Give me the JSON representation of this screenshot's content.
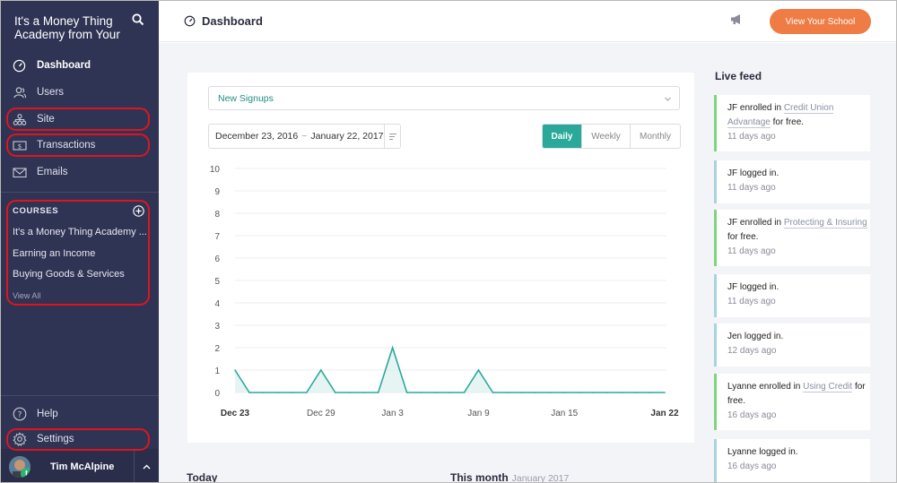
{
  "sidebar": {
    "brand": "It's a Money Thing Academy from Your",
    "nav": [
      {
        "label": "Dashboard",
        "icon": "gauge-icon"
      },
      {
        "label": "Users",
        "icon": "users-icon"
      },
      {
        "label": "Site",
        "icon": "sitemap-icon"
      },
      {
        "label": "Transactions",
        "icon": "money-icon"
      },
      {
        "label": "Emails",
        "icon": "envelope-icon"
      }
    ],
    "courses_heading": "COURSES",
    "courses": [
      "It's a Money Thing Academy ...",
      "Earning an Income",
      "Buying Goods & Services"
    ],
    "view_all": "View All",
    "help": "Help",
    "settings": "Settings",
    "user_name": "Tim McAlpine",
    "avatar_badge": "t"
  },
  "header": {
    "title": "Dashboard",
    "view_school": "View Your School"
  },
  "controls": {
    "metric": "New Signups",
    "date_start": "December 23, 2016",
    "date_sep": "~",
    "date_end": "January 22, 2017",
    "periods": [
      "Daily",
      "Weekly",
      "Monthly"
    ],
    "active_period": "Daily"
  },
  "chart_data": {
    "type": "area",
    "title": "",
    "xlabel": "",
    "ylabel": "",
    "ylim": [
      0,
      10
    ],
    "yticks": [
      0,
      1,
      2,
      3,
      4,
      5,
      6,
      7,
      8,
      9,
      10
    ],
    "x_tick_labels": [
      "Dec 23",
      "Dec 29",
      "Jan 3",
      "Jan 9",
      "Jan 15",
      "Jan 22"
    ],
    "x_tick_index": [
      0,
      6,
      11,
      17,
      23,
      30
    ],
    "x": [
      "Dec 23",
      "Dec 24",
      "Dec 25",
      "Dec 26",
      "Dec 27",
      "Dec 28",
      "Dec 29",
      "Dec 30",
      "Dec 31",
      "Jan 1",
      "Jan 2",
      "Jan 3",
      "Jan 4",
      "Jan 5",
      "Jan 6",
      "Jan 7",
      "Jan 8",
      "Jan 9",
      "Jan 10",
      "Jan 11",
      "Jan 12",
      "Jan 13",
      "Jan 14",
      "Jan 15",
      "Jan 16",
      "Jan 17",
      "Jan 18",
      "Jan 19",
      "Jan 20",
      "Jan 21",
      "Jan 22"
    ],
    "series": [
      {
        "values": [
          1,
          0,
          0,
          0,
          0,
          0,
          1,
          0,
          0,
          0,
          0,
          2,
          0,
          0,
          0,
          0,
          0,
          1,
          0,
          0,
          0,
          0,
          0,
          0,
          0,
          0,
          0,
          0,
          0,
          0,
          0
        ]
      }
    ],
    "grid": true,
    "color": "#2aa89a"
  },
  "below": {
    "today": "Today",
    "this_month": "This month",
    "this_month_sub": "January 2017"
  },
  "feed": {
    "title": "Live feed",
    "items": [
      {
        "pre": "JF enrolled in",
        "link": "Credit Union Advantage",
        "post": "for free.",
        "time": "11 days ago",
        "type": "green"
      },
      {
        "pre": "JF logged in.",
        "link": "",
        "post": "",
        "time": "11 days ago",
        "type": "blue"
      },
      {
        "pre": "JF enrolled in",
        "link": "Protecting & Insuring",
        "post": "for free.",
        "time": "11 days ago",
        "type": "green"
      },
      {
        "pre": "JF logged in.",
        "link": "",
        "post": "",
        "time": "11 days ago",
        "type": "blue"
      },
      {
        "pre": "Jen logged in.",
        "link": "",
        "post": "",
        "time": "12 days ago",
        "type": "blue"
      },
      {
        "pre": "Lyanne enrolled in",
        "link": "Using Credit",
        "post": "for free.",
        "time": "16 days ago",
        "type": "green"
      },
      {
        "pre": "Lyanne logged in.",
        "link": "",
        "post": "",
        "time": "16 days ago",
        "type": "blue"
      }
    ]
  }
}
